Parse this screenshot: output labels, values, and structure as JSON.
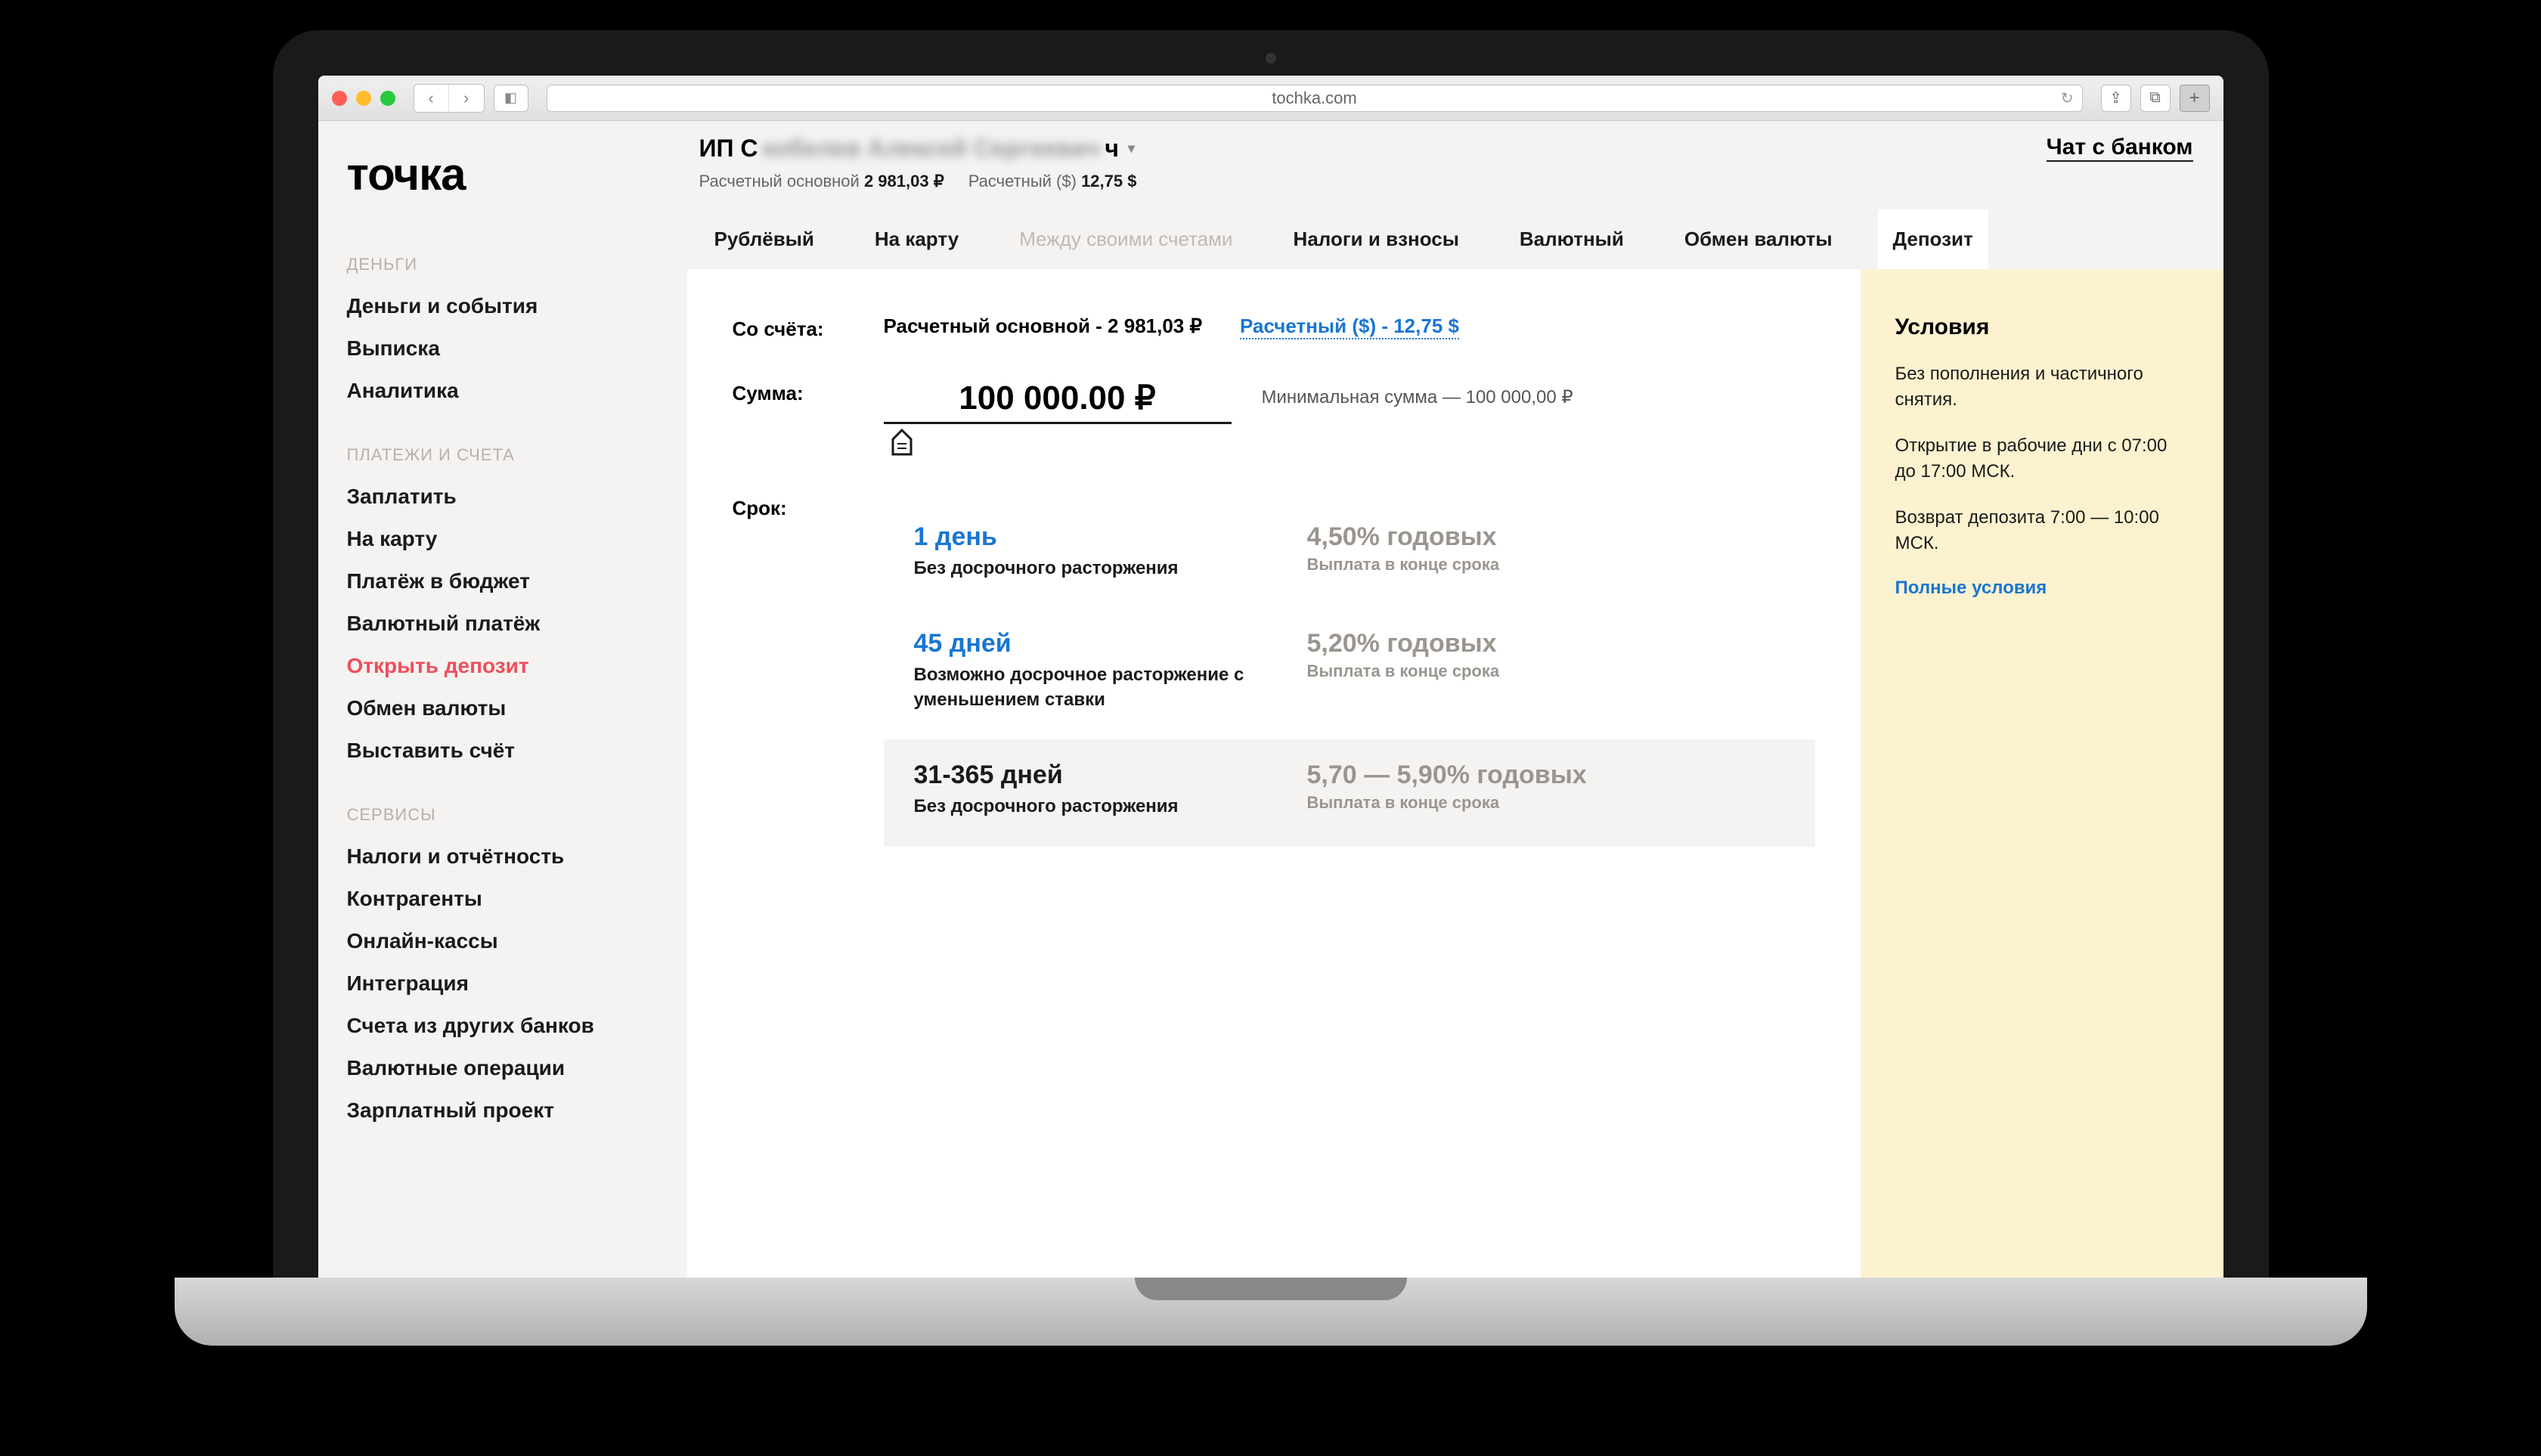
{
  "browser": {
    "url": "tochka.com"
  },
  "brand": "точка",
  "header": {
    "merchant_prefix": "ИП С",
    "merchant_blurred": "кобелев Алексей Сергеевич",
    "merchant_suffix": "ч",
    "chat_link": "Чат с банком",
    "balances": [
      {
        "label": "Расчетный основной",
        "value": "2 981,03 ₽"
      },
      {
        "label": "Расчетный ($)",
        "value": "12,75 $"
      }
    ]
  },
  "sidebar": {
    "sections": [
      {
        "title": "ДЕНЬГИ",
        "items": [
          "Деньги и события",
          "Выписка",
          "Аналитика"
        ]
      },
      {
        "title": "ПЛАТЕЖИ И СЧЕТА",
        "items": [
          "Заплатить",
          "На карту",
          "Платёж в бюджет",
          "Валютный платёж",
          "Открыть депозит",
          "Обмен валюты",
          "Выставить счёт"
        ],
        "active_index": 4
      },
      {
        "title": "СЕРВИСЫ",
        "items": [
          "Налоги и отчётность",
          "Контрагенты",
          "Онлайн-кассы",
          "Интеграция",
          "Счета из других банков",
          "Валютные операции",
          "Зарплатный проект"
        ]
      }
    ]
  },
  "tabs": {
    "items": [
      {
        "label": "Рублёвый",
        "state": "normal"
      },
      {
        "label": "На карту",
        "state": "normal"
      },
      {
        "label": "Между своими счетами",
        "state": "disabled"
      },
      {
        "label": "Налоги и взносы",
        "state": "normal"
      },
      {
        "label": "Валютный",
        "state": "normal"
      },
      {
        "label": "Обмен валюты",
        "state": "normal"
      },
      {
        "label": "Депозит",
        "state": "active"
      }
    ]
  },
  "form": {
    "from_label": "Со счёта:",
    "account_primary": "Расчетный основной - 2 981,03 ₽",
    "account_alt": "Расчетный ($) - 12,75 $",
    "amount_label": "Сумма:",
    "amount_value": "100 000.00 ₽",
    "min_amount": "Минимальная сумма — 100 000,00 ₽",
    "term_label": "Срок:",
    "terms": [
      {
        "title": "1 день",
        "sub": "Без досрочного расторжения",
        "rate": "4,50% годовых",
        "rate_sub": "Выплата в конце срока",
        "hl": false
      },
      {
        "title": "45 дней",
        "sub": "Возможно досрочное расторжение с уменьшением ставки",
        "rate": "5,20% годовых",
        "rate_sub": "Выплата в конце срока",
        "hl": false
      },
      {
        "title": "31-365 дней",
        "sub": "Без досрочного расторжения",
        "rate": "5,70 — 5,90% годовых",
        "rate_sub": "Выплата в конце срока",
        "hl": true
      }
    ]
  },
  "conditions": {
    "title": "Условия",
    "p1": "Без пополнения и частичного снятия.",
    "p2": "Открытие в рабочие дни с 07:00 до 17:00 МСК.",
    "p3": "Возврат депозита 7:00 — 10:00 МСК.",
    "link": "Полные условия"
  }
}
